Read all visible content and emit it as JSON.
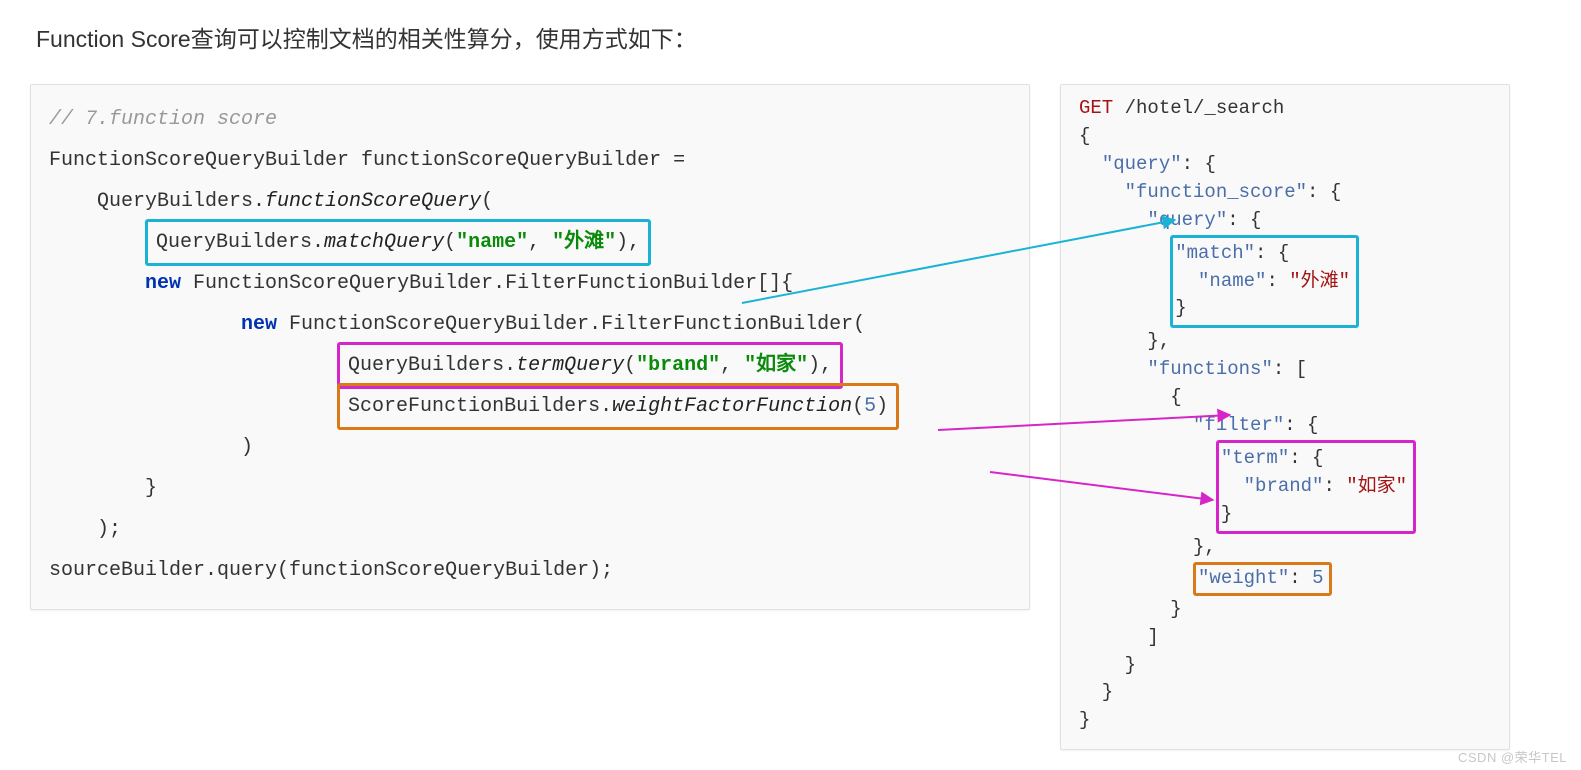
{
  "heading": "Function Score查询可以控制文档的相关性算分，使用方式如下：",
  "java": {
    "comment": "// 7.function score",
    "l1a": "FunctionScoreQueryBuilder functionScoreQueryBuilder =",
    "l2a": "    QueryBuilders.",
    "l2b": "functionScoreQuery",
    "l2c": "(",
    "box1_pre": "        ",
    "box1_a": "QueryBuilders.",
    "box1_b": "matchQuery",
    "box1_c": "(",
    "box1_s1": "\"name\"",
    "box1_d": ", ",
    "box1_s2": "\"外滩\"",
    "box1_e": "),",
    "l4a": "        ",
    "l4kw": "new",
    "l4b": " FunctionScoreQueryBuilder.FilterFunctionBuilder[]{",
    "l5a": "                ",
    "l5kw": "new",
    "l5b": " FunctionScoreQueryBuilder.FilterFunctionBuilder(",
    "box2_pre": "                        ",
    "box2_a": "QueryBuilders.",
    "box2_b": "termQuery",
    "box2_c": "(",
    "box2_s1": "\"brand\"",
    "box2_d": ", ",
    "box2_s2": "\"如家\"",
    "box2_e": "),",
    "box3_pre": "                        ",
    "box3_a": "ScoreFunctionBuilders.",
    "box3_b": "weightFactorFunction",
    "box3_c": "(",
    "box3_n": "5",
    "box3_d": ")",
    "l8": "                )",
    "l9": "        }",
    "l10": "    );",
    "l11": "sourceBuilder.query(functionScoreQueryBuilder);"
  },
  "json": {
    "l1a": "GET",
    "l1b": " /hotel/_search",
    "l2": "{",
    "l3a": "  ",
    "l3k": "\"query\"",
    "l3b": ": {",
    "l4a": "    ",
    "l4k": "\"function_score\"",
    "l4b": ": {",
    "l5a": "      ",
    "l5k": "\"query\"",
    "l5b": ": {",
    "m1a": "\"match\"",
    "m1b": ": {",
    "m2a": "  ",
    "m2k": "\"name\"",
    "m2b": ": ",
    "m2v": "\"外滩\"",
    "m3": "}",
    "l6a": "      },",
    "l7a": "      ",
    "l7k": "\"functions\"",
    "l7b": ": [",
    "l8": "        {",
    "l9a": "          ",
    "l9k": "\"filter\"",
    "l9b": ": {",
    "t1a": "\"term\"",
    "t1b": ": {",
    "t2a": "  ",
    "t2k": "\"brand\"",
    "t2b": ": ",
    "t2v": "\"如家\"",
    "t3": "}",
    "l10a": "          },",
    "w1k": "\"weight\"",
    "w1b": ": ",
    "w1v": "5",
    "l12": "        }",
    "l13": "      ]",
    "l14": "    }",
    "l15": "  }",
    "l16": "}"
  },
  "watermark": "CSDN @荣华TEL"
}
